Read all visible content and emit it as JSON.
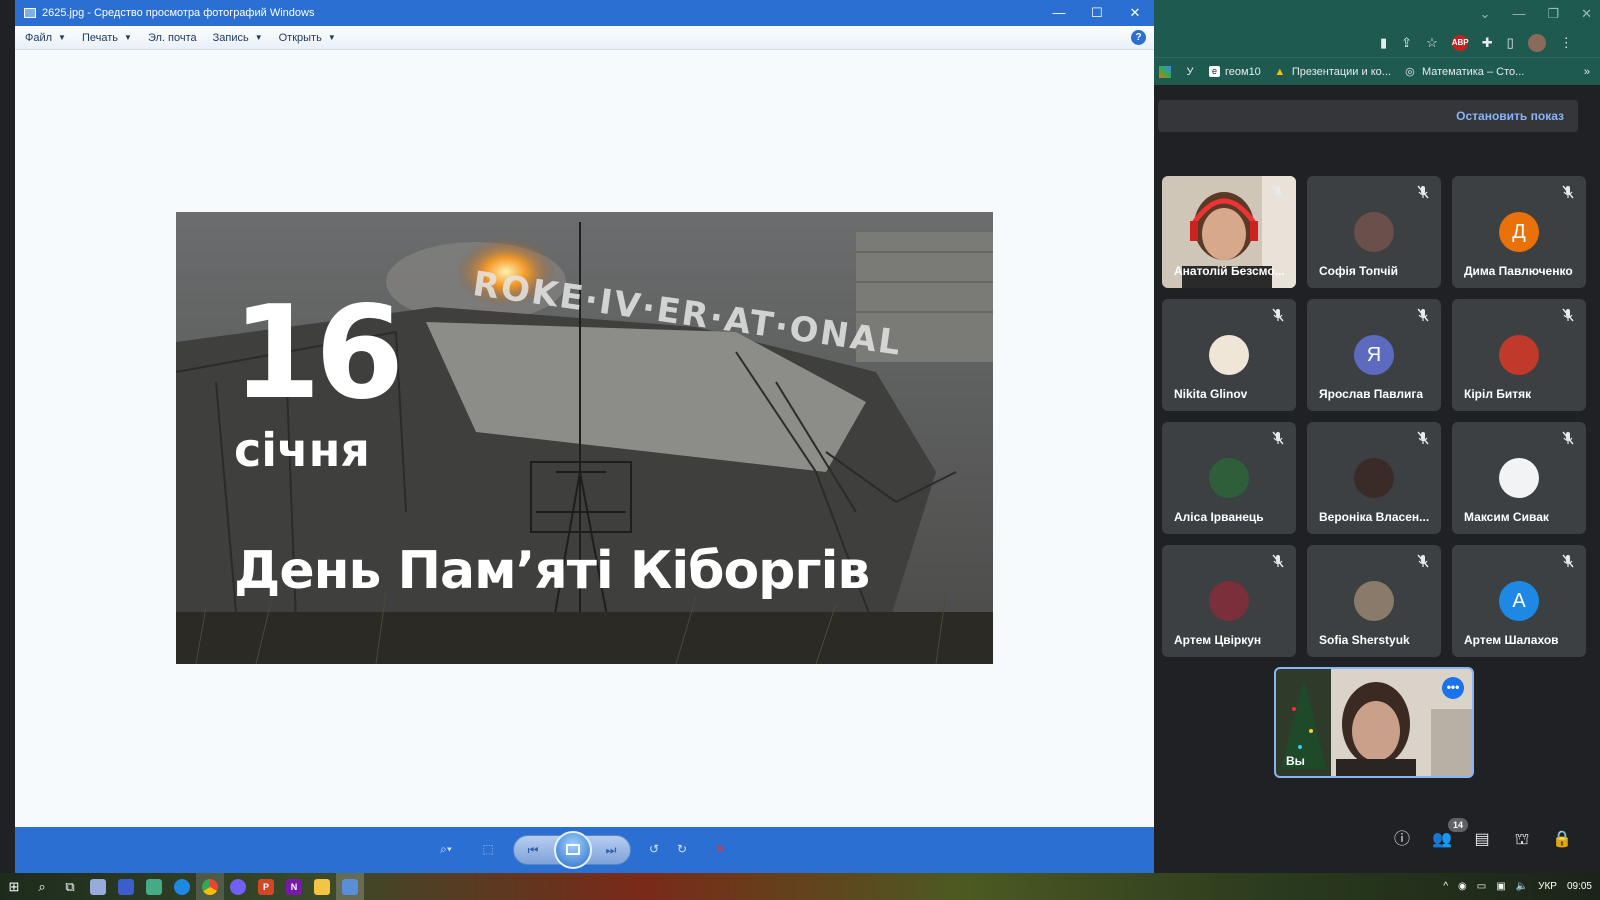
{
  "viewer": {
    "title": "2625.jpg - Средство просмотра фотографий Windows",
    "menu": [
      {
        "label": "Файл",
        "dropdown": true
      },
      {
        "label": "Печать",
        "dropdown": true
      },
      {
        "label": "Эл. почта",
        "dropdown": false
      },
      {
        "label": "Запись",
        "dropdown": true
      },
      {
        "label": "Открыть",
        "dropdown": true
      }
    ],
    "help": "?",
    "window_controls": {
      "minimize": "—",
      "maximize": "☐",
      "close": "✕"
    },
    "photo": {
      "day": "16",
      "month": "січня",
      "title": "День Пам’яті Кіборгів",
      "sign_text": "ROKE·IV·ER·AT·ONAL"
    },
    "nav": {
      "zoom": "⌕▾",
      "fit": "⬚",
      "previous": "⏮",
      "next": "⏭",
      "rotate_ccw": "↺",
      "rotate_cw": "↻",
      "delete": "✕"
    }
  },
  "chrome": {
    "window_controls": {
      "minimize": "—",
      "restore": "❐",
      "close": "✕",
      "chevron": "⌄"
    },
    "bookmarks": [
      {
        "icon": "У",
        "label": ""
      },
      {
        "icon": "e",
        "label": "геом10"
      },
      {
        "icon": "▲",
        "label": "Презентации и ко..."
      },
      {
        "icon": "◎",
        "label": "Математика – Сто..."
      }
    ],
    "bookmarks_more": "»",
    "abp_label": "ABP"
  },
  "meet": {
    "stop_presenting": "Остановить показ",
    "participants": [
      {
        "name": "Анатолій Безсмо...",
        "type": "video",
        "color": "#8a6a4a"
      },
      {
        "name": "Софія Топчій",
        "type": "photo",
        "color": "#6a4f4a"
      },
      {
        "name": "Дима Павлюченко",
        "type": "letter",
        "letter": "Д",
        "color": "#e8710a"
      },
      {
        "name": "Nikita Glinov",
        "type": "photo",
        "color": "#f0e6d8"
      },
      {
        "name": "Ярослав Павлига",
        "type": "letter",
        "letter": "Я",
        "color": "#5c6bc0"
      },
      {
        "name": "Кірiл Битяк",
        "type": "photo",
        "color": "#c0392b"
      },
      {
        "name": "Аліса Ірванець",
        "type": "photo",
        "color": "#2e5e3a"
      },
      {
        "name": "Вероніка Власен...",
        "type": "photo",
        "color": "#3a2a28"
      },
      {
        "name": "Максим Сивак",
        "type": "blank",
        "color": "#f1f3f4"
      },
      {
        "name": "Артем Цвіркун",
        "type": "photo",
        "color": "#7a2f3a"
      },
      {
        "name": "Sofia Sherstyuk",
        "type": "photo",
        "color": "#8a7a6a"
      },
      {
        "name": "Артем Шалахов",
        "type": "letter",
        "letter": "A",
        "color": "#1e88e5"
      }
    ],
    "self_name": "Вы",
    "people_count": "14"
  },
  "taskbar": {
    "lang": "УКР",
    "time": "09:05"
  }
}
